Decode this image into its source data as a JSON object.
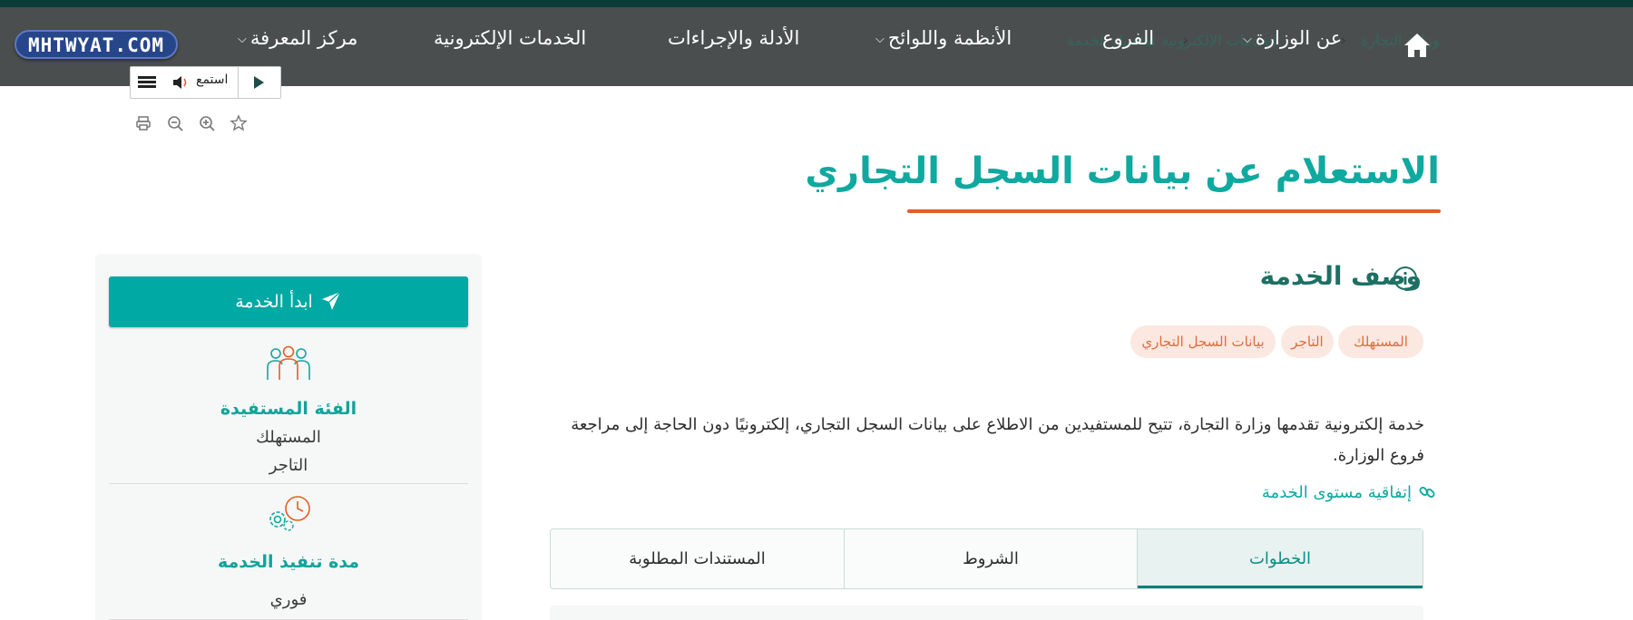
{
  "nav": {
    "logo_text": "MHTWYAT.COM",
    "items": [
      {
        "label": "مركز المعرفة",
        "has_dropdown": true
      },
      {
        "label": "الخدمات الإلكترونية",
        "has_dropdown": false
      },
      {
        "label": "الأدلة والإجراءات",
        "has_dropdown": false
      },
      {
        "label": "الأنظمة واللوائح",
        "has_dropdown": true
      },
      {
        "label": "الفروع",
        "has_dropdown": false
      },
      {
        "label": "عن الوزارة",
        "has_dropdown": true
      }
    ],
    "home_icon": "home-icon",
    "breadcrumb_ghost": [
      "وزارة التجارة",
      "الخدمات الإلكترونية",
      "تفاصيل الخدمة"
    ]
  },
  "reader": {
    "listen_label": "استمع",
    "icons": [
      "menu-icon",
      "speaker-icon",
      "play-icon"
    ]
  },
  "tools": [
    "print-icon",
    "zoom-out-icon",
    "zoom-in-icon",
    "star-icon"
  ],
  "page": {
    "title": "الاستعلام عن بيانات السجل التجاري",
    "accent_color": "#0fa99f",
    "rule_color": "#e35d26"
  },
  "service": {
    "heading": "وصف الخدمة",
    "tags": [
      "المستهلك",
      "التاجر",
      "بيانات السجل التجاري"
    ],
    "description": "خدمة إلكترونية تقدمها وزارة التجارة، تتيح للمستفيدين من الاطلاع على بيانات السجل التجاري، إلكترونيًا دون الحاجة إلى مراجعة فروع الوزارة.",
    "sla_link": "إتفاقية مستوى الخدمة"
  },
  "tabs": [
    {
      "label": "الخطوات",
      "active": true
    },
    {
      "label": "الشروط",
      "active": false
    },
    {
      "label": "المستندات المطلوبة",
      "active": false
    }
  ],
  "sidebar": {
    "start_button": "ابدأ الخدمة",
    "beneficiary_label": "الفئة المستفيدة",
    "beneficiaries": [
      "المستهلك",
      "التاجر"
    ],
    "duration_label": "مدة تنفيذ الخدمة",
    "duration_value": "فوري"
  }
}
